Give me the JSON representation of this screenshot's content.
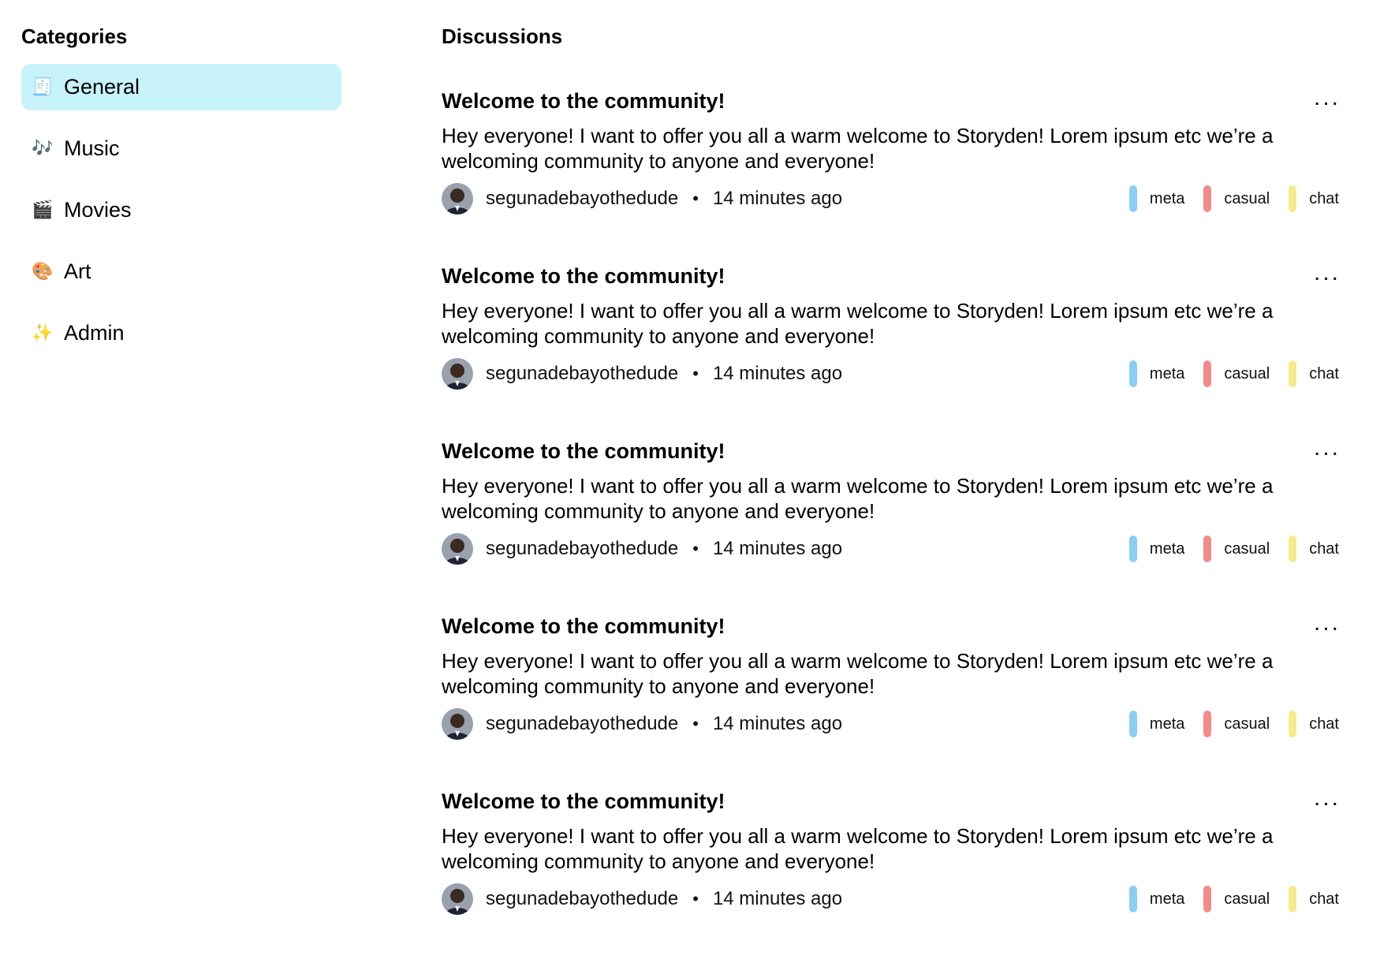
{
  "sidebar": {
    "title": "Categories",
    "items": [
      {
        "emoji": "🧾",
        "label": "General",
        "selected": true
      },
      {
        "emoji": "🎶",
        "label": "Music",
        "selected": false
      },
      {
        "emoji": "🎬",
        "label": "Movies",
        "selected": false
      },
      {
        "emoji": "🎨",
        "label": "Art",
        "selected": false
      },
      {
        "emoji": "✨",
        "label": "Admin",
        "selected": false
      }
    ]
  },
  "main": {
    "title": "Discussions",
    "threads": [
      {
        "title": "Welcome to the community!",
        "body": "Hey everyone! I want to offer you all a warm welcome to Storyden! Lorem ipsum etc we’re a welcoming community to anyone and everyone!",
        "author": "segunadebayothedude",
        "separator": "•",
        "time": "14 minutes ago",
        "tags": [
          {
            "label": "meta",
            "color": "#8ecdf2"
          },
          {
            "label": "casual",
            "color": "#f28b8b"
          },
          {
            "label": "chat",
            "color": "#f6ea8e"
          }
        ],
        "more_label": "..."
      },
      {
        "title": "Welcome to the community!",
        "body": "Hey everyone! I want to offer you all a warm welcome to Storyden! Lorem ipsum etc we’re a welcoming community to anyone and everyone!",
        "author": "segunadebayothedude",
        "separator": "•",
        "time": "14 minutes ago",
        "tags": [
          {
            "label": "meta",
            "color": "#8ecdf2"
          },
          {
            "label": "casual",
            "color": "#f28b8b"
          },
          {
            "label": "chat",
            "color": "#f6ea8e"
          }
        ],
        "more_label": "..."
      },
      {
        "title": "Welcome to the community!",
        "body": "Hey everyone! I want to offer you all a warm welcome to Storyden! Lorem ipsum etc we’re a welcoming community to anyone and everyone!",
        "author": "segunadebayothedude",
        "separator": "•",
        "time": "14 minutes ago",
        "tags": [
          {
            "label": "meta",
            "color": "#8ecdf2"
          },
          {
            "label": "casual",
            "color": "#f28b8b"
          },
          {
            "label": "chat",
            "color": "#f6ea8e"
          }
        ],
        "more_label": "..."
      },
      {
        "title": "Welcome to the community!",
        "body": "Hey everyone! I want to offer you all a warm welcome to Storyden! Lorem ipsum etc we’re a welcoming community to anyone and everyone!",
        "author": "segunadebayothedude",
        "separator": "•",
        "time": "14 minutes ago",
        "tags": [
          {
            "label": "meta",
            "color": "#8ecdf2"
          },
          {
            "label": "casual",
            "color": "#f28b8b"
          },
          {
            "label": "chat",
            "color": "#f6ea8e"
          }
        ],
        "more_label": "..."
      },
      {
        "title": "Welcome to the community!",
        "body": "Hey everyone! I want to offer you all a warm welcome to Storyden! Lorem ipsum etc we’re a welcoming community to anyone and everyone!",
        "author": "segunadebayothedude",
        "separator": "•",
        "time": "14 minutes ago",
        "tags": [
          {
            "label": "meta",
            "color": "#8ecdf2"
          },
          {
            "label": "casual",
            "color": "#f28b8b"
          },
          {
            "label": "chat",
            "color": "#f6ea8e"
          }
        ],
        "more_label": "..."
      }
    ]
  },
  "colors": {
    "selected_category_bg": "#c9f3fb",
    "text": "#000000",
    "avatar_bg": "#3b3f55"
  },
  "icons": {
    "more": "more-horizontal-icon",
    "avatar": "user-avatar"
  }
}
